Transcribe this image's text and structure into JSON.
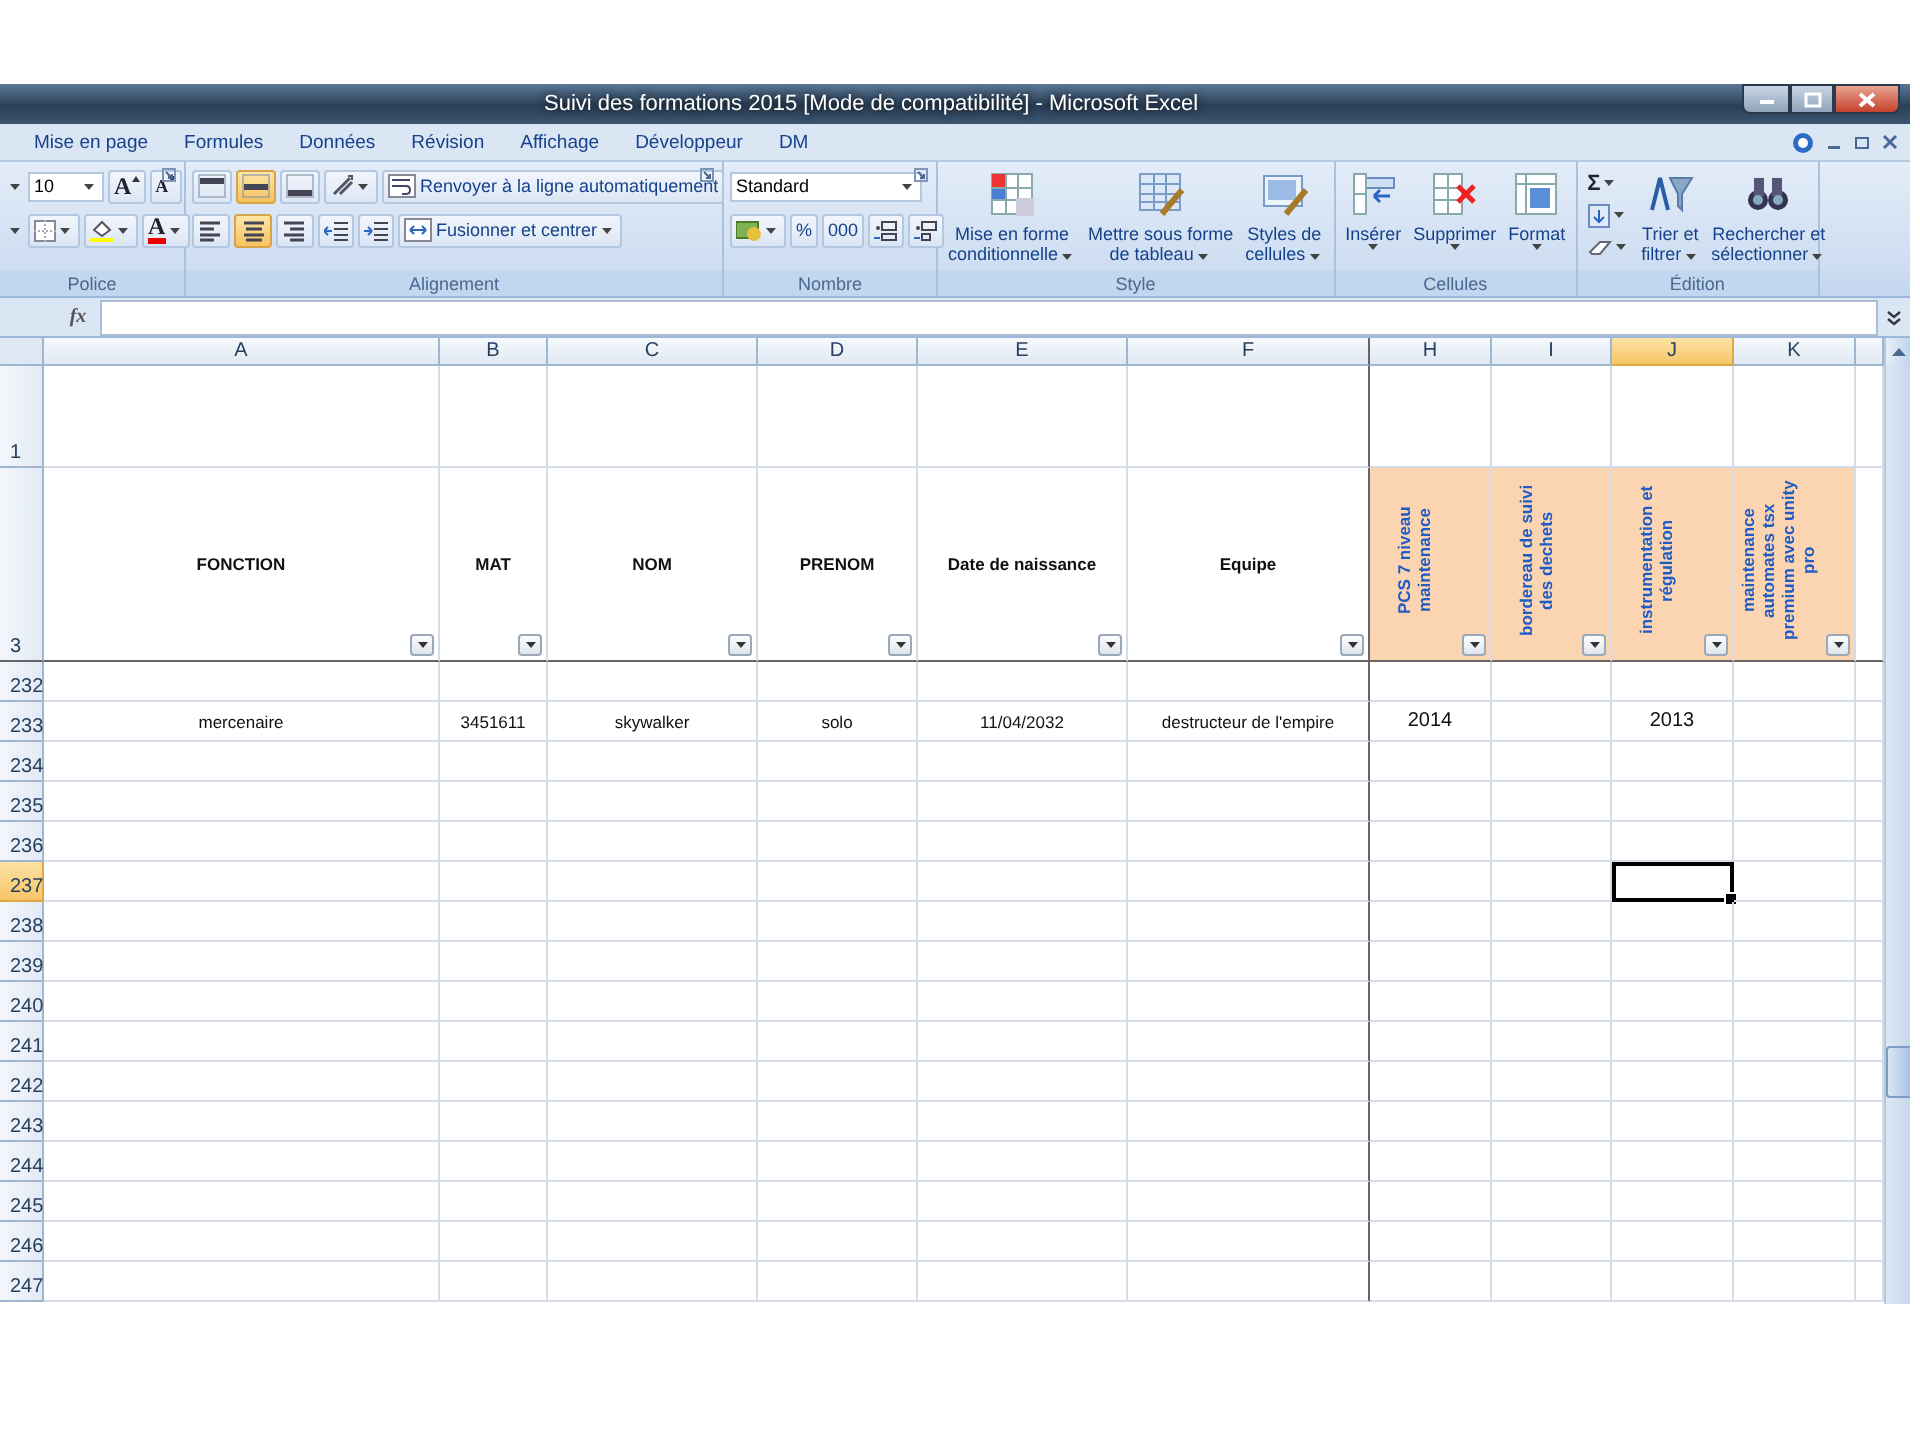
{
  "window": {
    "title": "Suivi des formations  2015  [Mode de compatibilité] - Microsoft Excel"
  },
  "menu_tabs": [
    "Mise en page",
    "Formules",
    "Données",
    "Révision",
    "Affichage",
    "Développeur",
    "DM"
  ],
  "ribbon": {
    "groups": [
      {
        "kind": "police",
        "label": "Police",
        "font_size": "10",
        "grow_font": "A",
        "shrink_font": "A",
        "font_color": "A"
      },
      {
        "kind": "alignement",
        "label": "Alignement",
        "vertical_align": [
          {
            "selected": false
          },
          {
            "selected": true
          },
          {
            "selected": false
          }
        ],
        "horizontal_align": [
          {
            "selected": false
          },
          {
            "selected": true
          },
          {
            "selected": false
          }
        ],
        "wrap_text": "Renvoyer à la ligne automatiquement",
        "merge_center": "Fusionner et centrer"
      },
      {
        "kind": "nombre",
        "label": "Nombre",
        "number_format": "Standard",
        "percent": "%",
        "thousands": "000"
      },
      {
        "kind": "buttons",
        "label": "Style",
        "buttons": [
          {
            "kind": "conditional",
            "lines": [
              "Mise en forme",
              "conditionnelle"
            ],
            "menu": true
          },
          {
            "kind": "table",
            "lines": [
              "Mettre sous forme",
              "de tableau"
            ],
            "menu": true
          },
          {
            "kind": "styles",
            "lines": [
              "Styles de",
              "cellules"
            ],
            "menu": true
          }
        ]
      },
      {
        "kind": "buttons",
        "label": "Cellules",
        "buttons": [
          {
            "kind": "insert",
            "lines": [
              "Insérer"
            ],
            "menu": true
          },
          {
            "kind": "delete",
            "lines": [
              "Supprimer"
            ],
            "menu": true
          },
          {
            "kind": "format",
            "lines": [
              "Format"
            ],
            "menu": true
          }
        ]
      },
      {
        "kind": "edition",
        "label": "Édition",
        "sum": "Σ",
        "buttons": [
          {
            "kind": "sort",
            "lines": [
              "Trier et",
              "filtrer"
            ],
            "menu": true
          },
          {
            "kind": "find",
            "lines": [
              "Rechercher et",
              "sélectionner"
            ],
            "menu": true
          }
        ]
      }
    ]
  },
  "formula_bar": {
    "fx": "fx"
  },
  "sheet": {
    "columns": [
      {
        "letter": "A",
        "selected": false,
        "header": "FONCTION",
        "vertical": false,
        "highlighted": false
      },
      {
        "letter": "B",
        "selected": false,
        "header": "MAT",
        "vertical": false,
        "highlighted": false
      },
      {
        "letter": "C",
        "selected": false,
        "header": "NOM",
        "vertical": false,
        "highlighted": false
      },
      {
        "letter": "D",
        "selected": false,
        "header": "PRENOM",
        "vertical": false,
        "highlighted": false
      },
      {
        "letter": "E",
        "selected": false,
        "header": "Date de naissance",
        "vertical": false,
        "highlighted": false
      },
      {
        "letter": "F",
        "selected": false,
        "header": "Equipe",
        "vertical": false,
        "highlighted": false
      },
      {
        "letter": "H",
        "selected": false,
        "header": "PCS 7 niveau maintenance",
        "vertical": true,
        "highlighted": true
      },
      {
        "letter": "I",
        "selected": false,
        "header": "bordereau de suivi des dechets",
        "vertical": true,
        "highlighted": true
      },
      {
        "letter": "J",
        "selected": true,
        "header": "instrumentation et régulation",
        "vertical": true,
        "highlighted": true
      },
      {
        "letter": "K",
        "selected": false,
        "header": "maintenance automates tsx premium avec unity pro",
        "vertical": true,
        "highlighted": true
      }
    ],
    "top_rows": [
      {
        "number": "1",
        "selected": false
      },
      {
        "number": "3",
        "selected": false
      }
    ],
    "rows": [
      {
        "number": "232",
        "selected": false
      },
      {
        "number": "233",
        "selected": false,
        "cells": {
          "A": "mercenaire",
          "B": "3451611",
          "C": "skywalker",
          "D": "solo",
          "E": "11/04/2032",
          "F": "destructeur de l'empire",
          "H": "2014",
          "J": "2013"
        }
      },
      {
        "number": "234",
        "selected": false
      },
      {
        "number": "235",
        "selected": false
      },
      {
        "number": "236",
        "selected": false
      },
      {
        "number": "237",
        "selected": true
      },
      {
        "number": "238",
        "selected": false
      },
      {
        "number": "239",
        "selected": false
      },
      {
        "number": "240",
        "selected": false
      },
      {
        "number": "241",
        "selected": false
      },
      {
        "number": "242",
        "selected": false
      },
      {
        "number": "243",
        "selected": false
      },
      {
        "number": "244",
        "selected": false
      },
      {
        "number": "245",
        "selected": false
      },
      {
        "number": "246",
        "selected": false
      },
      {
        "number": "247",
        "selected": false
      }
    ]
  }
}
